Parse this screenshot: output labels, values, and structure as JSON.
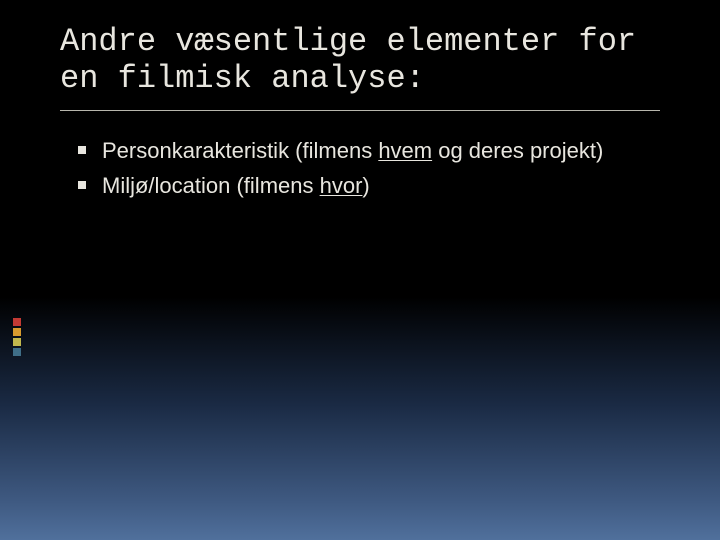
{
  "title": "Andre væsentlige elementer for en filmisk analyse:",
  "bullets": [
    {
      "pre": "Personkarakteristik (filmens ",
      "u": "hvem",
      "post": " og deres projekt)"
    },
    {
      "pre": "Miljø/location (filmens ",
      "u": "hvor",
      "post": ")"
    }
  ]
}
